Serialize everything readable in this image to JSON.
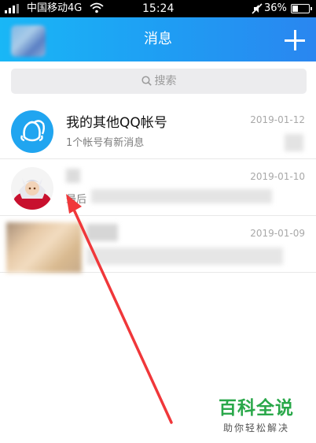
{
  "status_bar": {
    "carrier": "中国移动4G",
    "time": "15:24",
    "battery": "36%",
    "battery_level": 0.36
  },
  "header": {
    "title": "消息",
    "add_icon": "plus-icon"
  },
  "search": {
    "placeholder": "搜索",
    "icon": "search-icon"
  },
  "conversations": [
    {
      "name": "我的其他QQ帐号",
      "preview": "1个帐号有新消息",
      "date": "2019-01-12",
      "avatar": "qq-accounts-icon"
    },
    {
      "name": "",
      "preview": "最后",
      "date": "2019-01-10",
      "avatar": "red-character-avatar"
    },
    {
      "name": "",
      "preview": "",
      "date": "2019-01-09",
      "avatar": "blurred-avatar"
    }
  ],
  "watermark": {
    "title": "百科全说",
    "subtitle": "助你轻松解决"
  },
  "colors": {
    "header_start": "#19b7f6",
    "header_end": "#2a86f0",
    "arrow": "#f0373a",
    "watermark_green": "#2aa84a"
  }
}
